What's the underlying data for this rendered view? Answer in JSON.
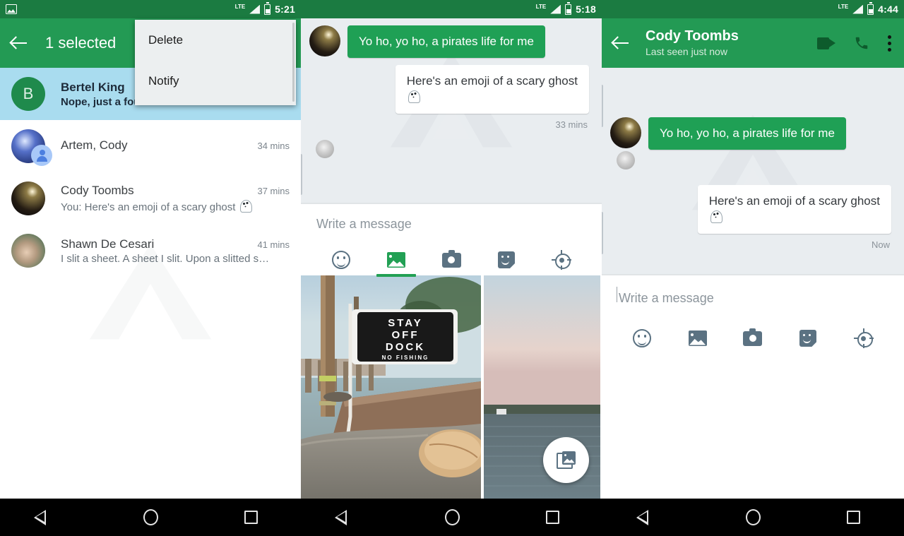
{
  "panels": {
    "left": {
      "status": {
        "time": "5:21",
        "network": "LTE",
        "icons": [
          "photo-icon",
          "signal-icon",
          "battery-icon"
        ]
      },
      "toolbar": {
        "title": "1 selected",
        "back_icon": "back-arrow-icon"
      },
      "overflow_menu": {
        "items": [
          {
            "label": "Delete"
          },
          {
            "label": "Notify"
          }
        ]
      },
      "conversations": [
        {
          "name": "Bertel King",
          "snippet": "Nope, just a fourth one.",
          "time": "",
          "avatar_initial": "B",
          "avatar_kind": "initial",
          "selected": true
        },
        {
          "name": "Artem, Cody",
          "snippet": "",
          "time": "34 mins",
          "avatar_initial": "",
          "avatar_kind": "group",
          "selected": false
        },
        {
          "name": "Cody Toombs",
          "snippet": "You: Here's an emoji of a scary ghost",
          "snippet_has_ghost": true,
          "time": "37 mins",
          "avatar_initial": "",
          "avatar_kind": "cody",
          "selected": false
        },
        {
          "name": "Shawn De Cesari",
          "snippet": "I slit a sheet. A sheet I slit. Upon a slitted s…",
          "time": "41 mins",
          "avatar_initial": "",
          "avatar_kind": "shawn",
          "selected": false
        }
      ]
    },
    "mid": {
      "status": {
        "time": "5:18",
        "network": "LTE"
      },
      "messages": [
        {
          "side": "in",
          "text": "Yo ho, yo ho, a pirates life for me",
          "style": "green",
          "avatar": "cody"
        },
        {
          "side": "out",
          "text": "Here's an emoji of a scary ghost",
          "style": "white",
          "has_ghost": true
        }
      ],
      "timestamp": "33 mins",
      "composer": {
        "placeholder": "Write a message",
        "tabs": [
          {
            "name": "emoji",
            "icon": "emoji-icon",
            "active": false
          },
          {
            "name": "gallery",
            "icon": "image-icon",
            "active": true
          },
          {
            "name": "camera",
            "icon": "camera-icon",
            "active": false
          },
          {
            "name": "sticker",
            "icon": "sticker-icon",
            "active": false
          },
          {
            "name": "location",
            "icon": "location-icon",
            "active": false
          }
        ]
      },
      "gallery": {
        "photos": [
          {
            "alt": "Dock with STAY OFF DOCK NO FISHING sign",
            "sign_lines": [
              "STAY",
              "OFF",
              "DOCK",
              "NO FISHING"
            ]
          },
          {
            "alt": "Lake at dusk"
          }
        ],
        "fab_icon": "photo-collection-icon"
      }
    },
    "right": {
      "status": {
        "time": "4:44",
        "network": "LTE"
      },
      "toolbar": {
        "title": "Cody Toombs",
        "subtitle": "Last seen just now",
        "back_icon": "back-arrow-icon",
        "actions": [
          "video-call-icon",
          "phone-icon",
          "overflow-menu-icon"
        ]
      },
      "messages": [
        {
          "side": "in",
          "text": "Yo ho, yo ho, a pirates life for me",
          "style": "green",
          "avatar": "cody"
        },
        {
          "side": "out",
          "text": "Here's an emoji of a scary ghost",
          "style": "white",
          "has_ghost": true
        }
      ],
      "timestamp": "Now",
      "composer": {
        "placeholder": "Write a message",
        "tabs": [
          {
            "name": "emoji",
            "icon": "emoji-icon",
            "active": false
          },
          {
            "name": "gallery",
            "icon": "image-icon",
            "active": false
          },
          {
            "name": "camera",
            "icon": "camera-icon",
            "active": false
          },
          {
            "name": "sticker",
            "icon": "sticker-icon",
            "active": false
          },
          {
            "name": "location",
            "icon": "location-icon",
            "active": false
          }
        ]
      }
    }
  },
  "navbar": {
    "buttons": [
      "back-nav-icon",
      "home-nav-icon",
      "recents-nav-icon"
    ]
  },
  "colors": {
    "status_green": "#1b7b41",
    "toolbar_green": "#239a54",
    "bubble_green": "#1fa055",
    "selection_blue": "#a9dcef",
    "chat_bg": "#e9edf0"
  }
}
